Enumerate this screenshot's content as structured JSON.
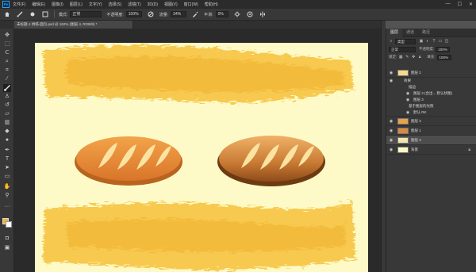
{
  "app": {
    "logo_text": "Ps"
  },
  "menu": {
    "items": [
      "文件(F)",
      "编辑(E)",
      "图像(I)",
      "图层(L)",
      "文字(Y)",
      "选择(S)",
      "滤镜(T)",
      "3D(D)",
      "视图(V)",
      "窗口(W)",
      "帮助(H)"
    ]
  },
  "window_controls": {
    "minimize": "—",
    "maximize": "☐",
    "close": "✕"
  },
  "options": {
    "mode_label": "模式:",
    "mode_value": "正常",
    "opacity_label": "不透明度:",
    "opacity_value": "100%",
    "flow_label": "流量:",
    "flow_value": "34%",
    "smooth_label": "平滑:",
    "smooth_value": "0%"
  },
  "document": {
    "tab_title": "未标题-1 烘焙-面包.psd @ 162% (图层 4, RGB/8) *"
  },
  "panel": {
    "tabs": [
      "图层",
      "通道",
      "路径"
    ],
    "filter_label": "类型",
    "blend_mode": "正常",
    "opacity_label": "不透明度:",
    "opacity_value": "100%",
    "lock_label": "锁定:",
    "fill_label": "填充:",
    "fill_value": "100%"
  },
  "layers": [
    {
      "name": "图层 2",
      "kind": "layer",
      "thumb_color": "#f7d98a",
      "selected": false
    },
    {
      "name": "效果",
      "kind": "fx",
      "selected": false
    },
    {
      "name": "描边",
      "kind": "sub",
      "selected": false
    },
    {
      "name": "图层 3 (合出... 默认状图)",
      "kind": "sub",
      "selected": false
    },
    {
      "name": "图层 3",
      "kind": "sub",
      "selected": false
    },
    {
      "name": "基于图层的光照",
      "kind": "sub",
      "selected": false
    },
    {
      "name": "默认 RK",
      "kind": "sub",
      "selected": false
    },
    {
      "name": "图层 3",
      "kind": "layer",
      "thumb_color": "#e9a14b",
      "selected": false
    },
    {
      "name": "图层 1",
      "kind": "layer",
      "thumb_color": "#d98a3a",
      "selected": false
    },
    {
      "name": "图层 4",
      "kind": "layer",
      "thumb_color": "#f3e7b0",
      "selected": true
    },
    {
      "name": "背景",
      "kind": "layer",
      "thumb_color": "#fefac7",
      "selected": false
    }
  ],
  "colors": {
    "canvas_bg": "#fefac7",
    "brush_yellow": "#f6c441",
    "bread_orange": "#e8872c",
    "bread_brown": "#b8641f",
    "foreground": "#f0b43a",
    "background": "#ffffff"
  },
  "tools": [
    "move-icon",
    "marquee-icon",
    "lasso-icon",
    "quick-select-icon",
    "crop-icon",
    "eyedropper-icon",
    "healing-icon",
    "brush-icon",
    "stamp-icon",
    "history-brush-icon",
    "eraser-icon",
    "gradient-icon",
    "blur-icon",
    "dodge-icon",
    "pen-icon",
    "type-icon",
    "path-select-icon",
    "shape-icon",
    "hand-icon",
    "zoom-icon"
  ]
}
